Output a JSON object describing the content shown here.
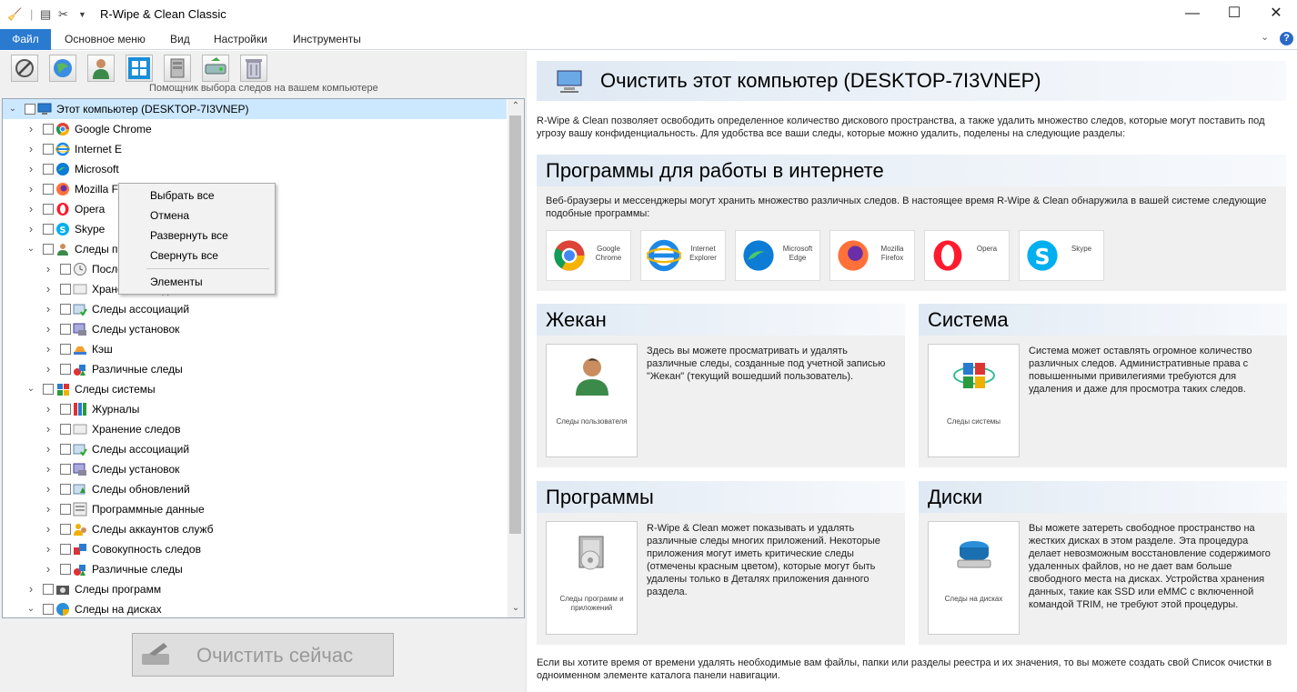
{
  "titlebar": {
    "title": "R-Wipe & Clean Classic",
    "controls": {
      "minimize": "—",
      "maximize": "☐",
      "close": "✕"
    }
  },
  "menu": {
    "tabs": [
      "Файл",
      "Основное меню",
      "Вид",
      "Настройки",
      "Инструменты"
    ],
    "help_label": "?"
  },
  "toolbar": {
    "buttons": [
      "wizard-icon",
      "internet-icon",
      "user-icon",
      "windows-icon",
      "programs-icon",
      "drives-icon",
      "trash-icon"
    ],
    "caption": "Помощник выбора следов на вашем компьютере"
  },
  "tree": {
    "root": "Этот компьютер  (DESKTOP-7I3VNEP)",
    "items": [
      {
        "label": "Google Chrome",
        "icon": "chrome-icon"
      },
      {
        "label": "Internet E",
        "icon": "ie-icon"
      },
      {
        "label": "Microsoft",
        "icon": "edge-icon"
      },
      {
        "label": "Mozilla Fi",
        "icon": "firefox-icon"
      },
      {
        "label": "Opera",
        "icon": "opera-icon"
      },
      {
        "label": "Skype",
        "icon": "skype-icon"
      },
      {
        "label": "Следы пользователя Жекан",
        "icon": "user-icon"
      },
      {
        "label": "Последние действия",
        "icon": "clock-icon"
      },
      {
        "label": "Хранение следов",
        "icon": "storage-icon"
      },
      {
        "label": "Следы ассоциаций",
        "icon": "assoc-icon"
      },
      {
        "label": "Следы установок",
        "icon": "install-icon"
      },
      {
        "label": "Кэш",
        "icon": "cache-icon"
      },
      {
        "label": "Различные следы",
        "icon": "misc-icon"
      },
      {
        "label": "Следы системы",
        "icon": "system-icon"
      },
      {
        "label": "Журналы",
        "icon": "logs-icon"
      },
      {
        "label": "Хранение следов",
        "icon": "storage-icon"
      },
      {
        "label": "Следы ассоциаций",
        "icon": "assoc-icon"
      },
      {
        "label": "Следы установок",
        "icon": "install-icon"
      },
      {
        "label": "Следы обновлений",
        "icon": "update-icon"
      },
      {
        "label": "Программные данные",
        "icon": "progdata-icon"
      },
      {
        "label": "Следы аккаунтов служб",
        "icon": "accounts-icon"
      },
      {
        "label": "Совокупность следов",
        "icon": "aggregate-icon"
      },
      {
        "label": "Различные следы",
        "icon": "misc-icon"
      },
      {
        "label": "Следы программ",
        "icon": "camera-icon"
      },
      {
        "label": "Следы на дисках",
        "icon": "disk-icon"
      }
    ]
  },
  "context_menu": {
    "items": [
      "Выбрать все",
      "Отмена",
      "Развернуть все",
      "Свернуть все"
    ],
    "last": "Элементы"
  },
  "clean_button": "Очистить сейчас",
  "right": {
    "main_title": "Очистить этот компьютер  (DESKTOP-7I3VNEP)",
    "intro": "R-Wipe & Clean позволяет освободить определенное количество дискового пространства, а также удалить множество следов, которые могут поставить под угрозу вашу конфиденциальность. Для удобства все ваши следы, которые можно удалить, поделены на следующие разделы:",
    "internet": {
      "title": "Программы для работы в интернете",
      "text": "Веб-браузеры и мессенджеры могут хранить множество различных следов. В настоящее время R-Wipe & Clean обнаружила в вашей системе следующие подобные программы:",
      "browsers": [
        {
          "label": "Google Chrome",
          "icon": "chrome-icon"
        },
        {
          "label": "Internet Explorer",
          "icon": "ie-icon"
        },
        {
          "label": "Microsoft Edge",
          "icon": "edge-icon"
        },
        {
          "label": "Mozilla Firefox",
          "icon": "firefox-icon"
        },
        {
          "label": "Opera",
          "icon": "opera-icon"
        },
        {
          "label": "Skype",
          "icon": "skype-icon"
        }
      ]
    },
    "user": {
      "title": "Жекан",
      "card": "Следы пользователя",
      "text": "Здесь вы можете просматривать и удалять различные следы, созданные под учетной записью \"Жекан\" (текущий вошедший пользователь)."
    },
    "system": {
      "title": "Система",
      "card": "Следы системы",
      "text": "Система может оставлять огромное количество различных следов. Административные права с повышенными привилегиями требуются для удаления и даже для просмотра таких следов."
    },
    "programs": {
      "title": "Программы",
      "card": "Следы программ и приложений",
      "text": "R-Wipe & Clean может показывать и удалять различные следы многих приложений. Некоторые приложения могут иметь критические следы (отмечены красным цветом), которые могут быть удалены только в Деталях приложения данного раздела."
    },
    "disks": {
      "title": "Диски",
      "card": "Следы на дисках",
      "text": "Вы можете затереть свободное пространство на жестких дисках в этом разделе. Эта процедура делает невозможным восстановление содержимого удаленных файлов, но не дает вам больше свободного места на дисках. Устройства хранения данных, такие как SSD или eMMC с включенной командой TRIM, не требуют этой процедуры."
    },
    "footer": "Если вы хотите время от времени удалять необходимые вам файлы, папки или разделы реестра и их значения, то вы можете создать свой Список очистки в одноименном элементе каталога  панели навигации."
  },
  "colors": {
    "accent": "#2a7bd0",
    "selection": "#cce8ff",
    "header": "#dfe9f3"
  }
}
